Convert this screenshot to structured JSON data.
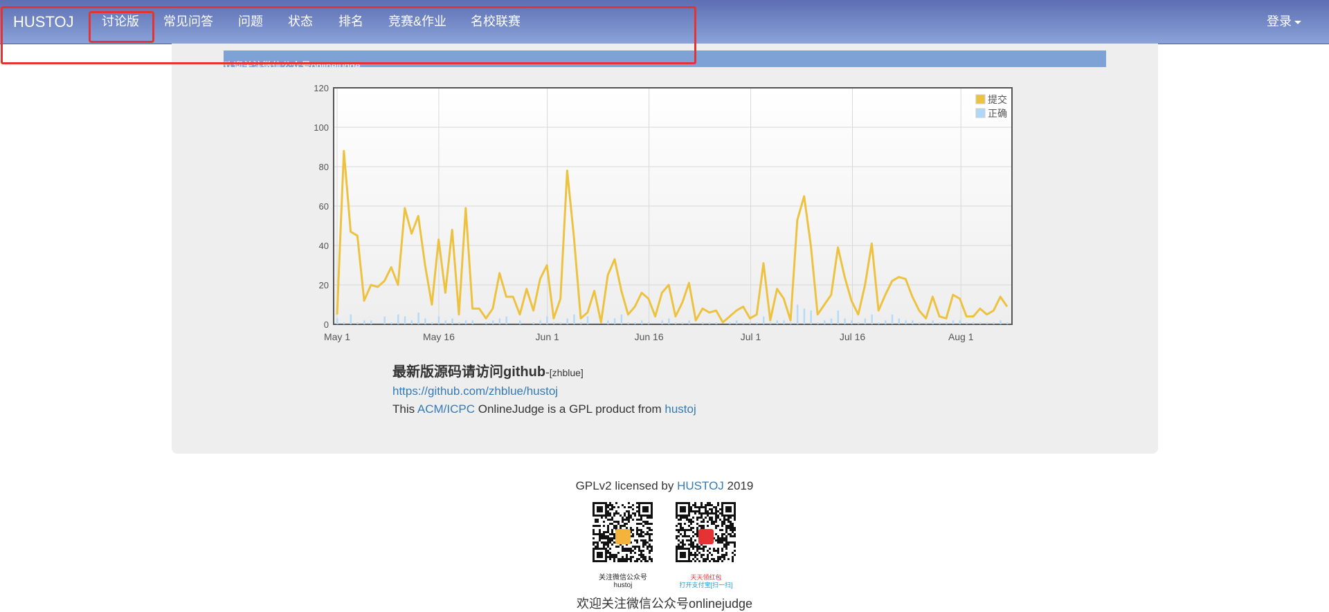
{
  "navbar": {
    "brand": "HUSTOJ",
    "items": [
      "讨论版",
      "常见问答",
      "问题",
      "状态",
      "排名",
      "竞赛&作业",
      "名校联赛"
    ],
    "login": "登录"
  },
  "marquee": {
    "text": "欢迎关注微信公众号onlinejudge"
  },
  "chart_data": {
    "type": "line",
    "ylim": [
      0,
      120
    ],
    "yticks": [
      "0",
      "20",
      "40",
      "60",
      "80",
      "100",
      "120"
    ],
    "xticks": [
      "May 1",
      "May 16",
      "Jun 1",
      "Jun 16",
      "Jul 1",
      "Jul 16",
      "Aug 1"
    ],
    "grid": true,
    "legend_position": "top-right",
    "series": [
      {
        "name": "提交",
        "color": "#edc240",
        "values": [
          5,
          88,
          47,
          45,
          12,
          20,
          19,
          22,
          29,
          20,
          59,
          46,
          55,
          30,
          10,
          43,
          16,
          48,
          5,
          59,
          8,
          8,
          3,
          8,
          26,
          14,
          14,
          5,
          18,
          7,
          23,
          30,
          3,
          13,
          78,
          44,
          3,
          6,
          17,
          1,
          25,
          33,
          17,
          5,
          9,
          16,
          13,
          4,
          16,
          20,
          4,
          11,
          21,
          2,
          8,
          6,
          7,
          1,
          4,
          7,
          9,
          3,
          5,
          31,
          2,
          18,
          13,
          2,
          53,
          65,
          40,
          5,
          10,
          15,
          39,
          24,
          12,
          5,
          20,
          41,
          7,
          15,
          22,
          24,
          23,
          14,
          7,
          3,
          14,
          4,
          3,
          15,
          13,
          4,
          4,
          8,
          5,
          7,
          14,
          9
        ]
      },
      {
        "name": "正确",
        "color": "#afd8f8",
        "values": [
          3,
          1,
          5,
          1,
          2,
          2,
          0,
          4,
          1,
          5,
          4,
          2,
          6,
          3,
          1,
          4,
          2,
          3,
          1,
          2,
          2,
          0,
          1,
          2,
          3,
          4,
          0,
          2,
          0,
          1,
          2,
          4,
          1,
          1,
          3,
          5,
          1,
          4,
          0,
          0,
          2,
          3,
          5,
          1,
          1,
          2,
          1,
          0,
          2,
          3,
          1,
          1,
          2,
          0,
          1,
          1,
          1,
          0,
          1,
          2,
          1,
          1,
          1,
          4,
          1,
          2,
          2,
          1,
          10,
          8,
          7,
          1,
          2,
          3,
          7,
          3,
          2,
          1,
          3,
          5,
          1,
          2,
          5,
          3,
          2,
          2,
          1,
          1,
          2,
          1,
          1,
          2,
          2,
          1,
          1,
          1,
          1,
          1,
          2,
          1
        ]
      }
    ]
  },
  "info": {
    "title": "最新版源码请访问github",
    "dash": "-",
    "author": "[zhblue]",
    "repo_url": "https://github.com/zhblue/hustoj",
    "line_pre": "This ",
    "line_link1": "ACM/ICPC",
    "line_mid": " OnlineJudge is a GPL product from ",
    "line_link2": "hustoj"
  },
  "footer": {
    "pre": "GPLv2 licensed by ",
    "link": "HUSTOJ",
    "year": " 2019",
    "qr1_caption_line1": "关注微信公众号",
    "qr1_caption_line2": "hustoj",
    "qr2_caption_line1": "天天领红包",
    "qr2_caption_line2": "打开支付宝[扫一扫]",
    "bottom": "欢迎关注微信公众号onlinejudge"
  }
}
